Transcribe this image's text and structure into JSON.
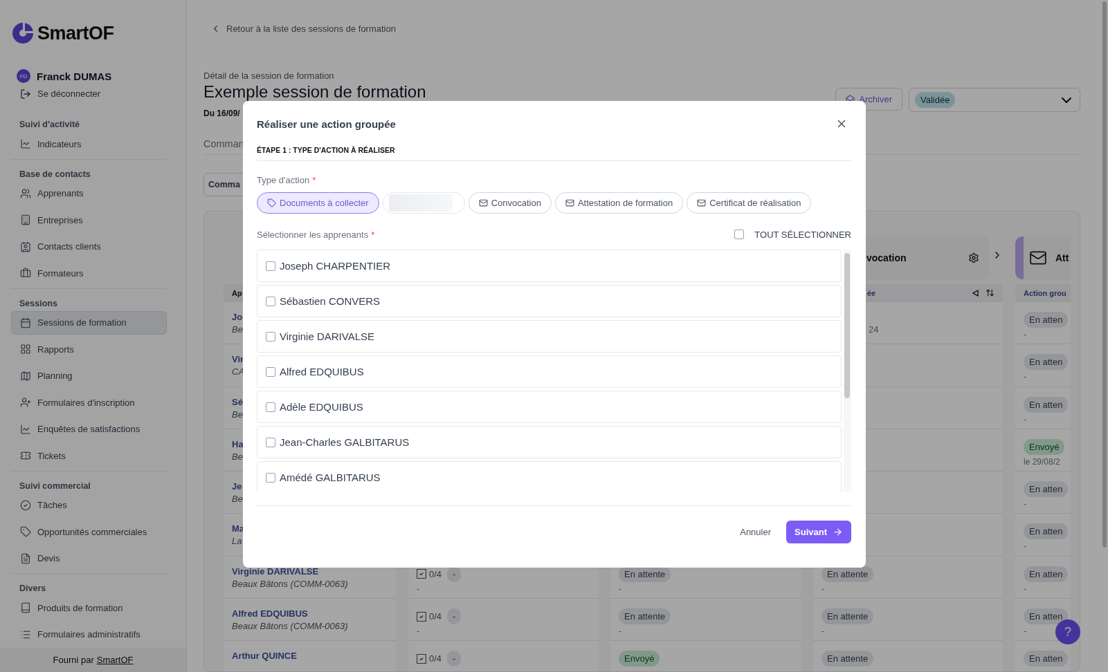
{
  "sidebar": {
    "logo": "SmartOF",
    "user": {
      "initials": "FD",
      "name": "Franck DUMAS"
    },
    "logout": "Se déconnecter",
    "sections": [
      {
        "title": "Suivi d'activité",
        "items": [
          {
            "label": "Indicateurs",
            "selected": false
          }
        ]
      },
      {
        "title": "Base de contacts",
        "items": [
          {
            "label": "Apprenants",
            "selected": false
          },
          {
            "label": "Entreprises",
            "selected": false
          },
          {
            "label": "Contacts clients",
            "selected": false
          },
          {
            "label": "Formateurs",
            "selected": false
          }
        ]
      },
      {
        "title": "Sessions",
        "items": [
          {
            "label": "Sessions de formation",
            "selected": true
          },
          {
            "label": "Rapports",
            "selected": false
          },
          {
            "label": "Planning",
            "selected": false
          },
          {
            "label": "Formulaires d'inscription",
            "selected": false
          },
          {
            "label": "Enquêtes de satisfactions",
            "selected": false
          },
          {
            "label": "Tickets",
            "selected": false
          }
        ]
      },
      {
        "title": "Suivi commercial",
        "items": [
          {
            "label": "Tâches",
            "selected": false
          },
          {
            "label": "Opportunités commerciales",
            "selected": false
          },
          {
            "label": "Devis",
            "selected": false
          }
        ]
      },
      {
        "title": "Divers",
        "items": [
          {
            "label": "Produits de formation",
            "selected": false
          },
          {
            "label": "Formulaires administratifs",
            "selected": false
          }
        ]
      }
    ],
    "footer": {
      "text": "Fourni par",
      "link": "SmartOF"
    }
  },
  "page": {
    "back": "Retour à la liste des sessions de formation",
    "overline": "Détail de la session de formation",
    "title": "Exemple session de formation",
    "dates": "Du 16/09/",
    "archive": "Archiver",
    "status": "Validée",
    "tab": "Comman",
    "button": "Comma"
  },
  "table": {
    "first_header": "Ap",
    "col4": {
      "title": "vocation",
      "sub": "ée"
    },
    "col5": {
      "title": "Att",
      "sub": "Action grou"
    },
    "rows": [
      {
        "name": "Jo",
        "company": "Be",
        "c4": {
          "date": "24"
        },
        "c5": {
          "kind": "pending",
          "status": "En atten",
          "date": "-"
        }
      },
      {
        "name": "Vir",
        "company": "CA",
        "c5": {
          "kind": "pending",
          "status": "En atten",
          "date": "-"
        }
      },
      {
        "name": "Sé",
        "company": "Be",
        "c5": {
          "kind": "pending",
          "status": "En atten",
          "date": "-"
        }
      },
      {
        "name": "Ha",
        "company": "Be",
        "c5": {
          "kind": "sent",
          "status": "Envoyé",
          "date": "le 29/08/2"
        }
      },
      {
        "name": "Je",
        "company": "Be",
        "c5": {
          "kind": "pending",
          "status": "En atten",
          "date": "-"
        }
      },
      {
        "name": "Ma",
        "company": "La",
        "c5": {
          "kind": "pending",
          "status": "En atten",
          "date": "-"
        }
      },
      {
        "name": "Virginie DARIVALSE",
        "company": "Beaux Bâtons (COMM-0063)",
        "docs": {
          "count": "0/4",
          "badge": "-",
          "sub": "-"
        },
        "c3": {
          "kind": "pending",
          "status": "En attente",
          "date": "-"
        },
        "c4": {
          "kind": "pending",
          "status": "En attente",
          "date": "-"
        },
        "c5": {
          "kind": "pending",
          "status": "En atten",
          "date": "-"
        }
      },
      {
        "name": "Alfred EDQUIBUS",
        "company": "Beaux Bâtons (COMM-0063)",
        "docs": {
          "count": "0/4",
          "badge": "-",
          "sub": "-"
        },
        "c3": {
          "kind": "pending",
          "status": "En attente",
          "date": "-"
        },
        "c4": {
          "kind": "pending",
          "status": "En attente",
          "date": "-"
        },
        "c5": {
          "kind": "pending",
          "status": "En atten",
          "date": "-"
        }
      },
      {
        "name": "Arthur QUINCE",
        "docs": {
          "count": "0/4",
          "badge": "-"
        },
        "c3": {
          "kind": "sent",
          "status": "Envoyé"
        },
        "c4": {
          "kind": "pending",
          "status": "En attente"
        },
        "c5": {
          "kind": "pending",
          "status": "En atten"
        }
      }
    ]
  },
  "modal": {
    "title": "Réaliser une action groupée",
    "step": "ÉTAPE 1 : TYPE D'ACTION À RÉALISER",
    "action_label": "Type d'action",
    "action_required": "*",
    "actions": [
      {
        "kind": "tag",
        "label": "Documents à collecter",
        "selected": true
      },
      {
        "kind": "loading",
        "selected": false
      },
      {
        "kind": "mail",
        "label": "Convocation",
        "selected": false
      },
      {
        "kind": "mail",
        "label": "Attestation de formation",
        "selected": false
      },
      {
        "kind": "mail",
        "label": "Certificat de réalisation",
        "selected": false
      }
    ],
    "learners_label": "Sélectionner les apprenants",
    "learners_required": "*",
    "select_all": {
      "label": "TOUT SÉLECTIONNER",
      "checked": false
    },
    "learners": [
      {
        "name": "Joseph CHARPENTIER",
        "checked": false
      },
      {
        "name": "Sébastien CONVERS",
        "checked": false
      },
      {
        "name": "Virginie DARIVALSE",
        "checked": false
      },
      {
        "name": "Alfred EDQUIBUS",
        "checked": false
      },
      {
        "name": "Adèle EDQUIBUS",
        "checked": false
      },
      {
        "name": "Jean-Charles GALBITARUS",
        "checked": false
      },
      {
        "name": "Amédé GALBITARUS",
        "checked": false
      }
    ],
    "cancel": "Annuler",
    "next": "Suivant"
  },
  "help": "?"
}
